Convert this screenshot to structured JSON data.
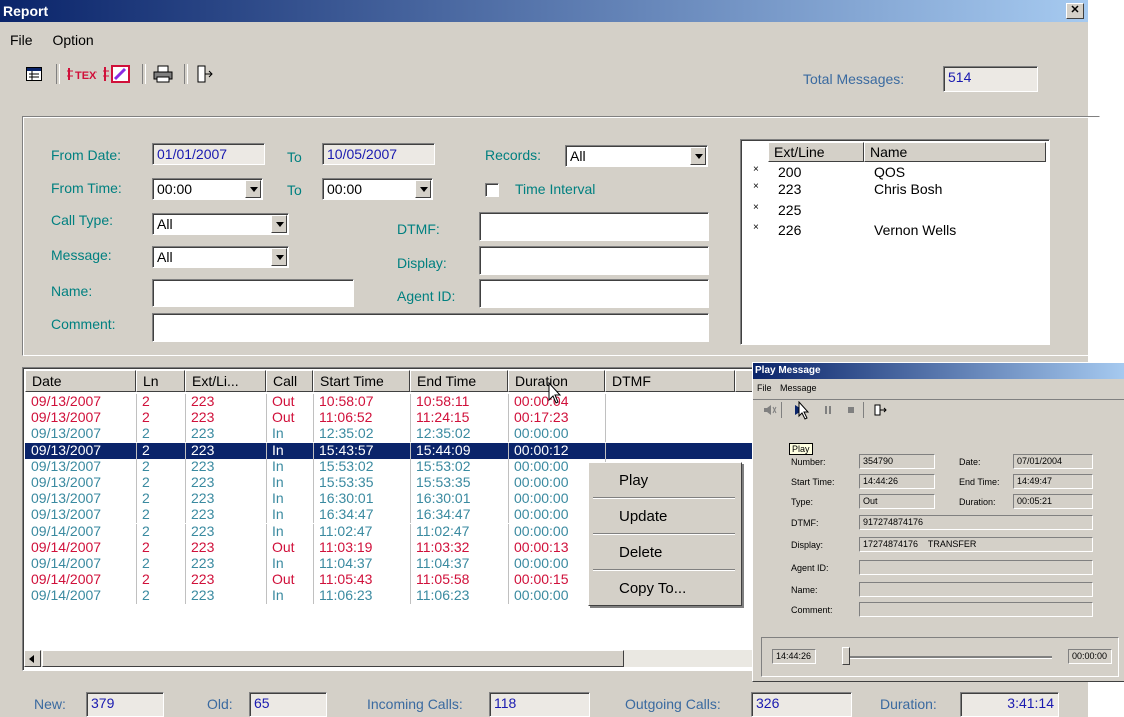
{
  "window": {
    "title": "Report",
    "close_glyph": "✕"
  },
  "menu": [
    "File",
    "Option"
  ],
  "toolbar": {
    "icons": [
      "report-view-icon",
      "text-export-icon",
      "edit-export-icon",
      "print-icon",
      "exit-icon"
    ],
    "total_label": "Total Messages:",
    "total_value": "514"
  },
  "filters": {
    "from_date_label": "From Date:",
    "from_date": "01/01/2007",
    "to_label": "To",
    "to_date": "10/05/2007",
    "records_label": "Records:",
    "records_value": "All",
    "from_time_label": "From Time:",
    "from_time": "00:00",
    "to_time_label": "To",
    "to_time": "00:00",
    "time_interval_label": "Time Interval",
    "call_type_label": "Call Type:",
    "call_type_value": "All",
    "dtmf_label": "DTMF:",
    "dtmf_value": "",
    "message_label": "Message:",
    "message_value": "All",
    "display_label": "Display:",
    "display_value": "",
    "name_label": "Name:",
    "name_value": "",
    "agent_label": "Agent ID:",
    "agent_value": "",
    "comment_label": "Comment:",
    "comment_value": ""
  },
  "ext_list": {
    "headers": [
      "Ext/Line",
      "Name"
    ],
    "rows": [
      {
        "mark": "×",
        "ext": "200",
        "name": "QOS"
      },
      {
        "mark": "×",
        "ext": "223",
        "name": "Chris Bosh"
      },
      {
        "mark": "×",
        "ext": "225",
        "name": ""
      },
      {
        "mark": "×",
        "ext": "226",
        "name": "Vernon Wells"
      }
    ]
  },
  "grid": {
    "headers": [
      "Date",
      "Ln",
      "Ext/Li...",
      "Call",
      "Start Time",
      "End Time",
      "Duration",
      "DTMF"
    ],
    "rows": [
      {
        "date": "09/13/2007",
        "ln": "2",
        "ext": "223",
        "call": "Out",
        "start": "10:58:07",
        "end": "10:58:11",
        "dur": "00:00:04",
        "type": "out"
      },
      {
        "date": "09/13/2007",
        "ln": "2",
        "ext": "223",
        "call": "Out",
        "start": "11:06:52",
        "end": "11:24:15",
        "dur": "00:17:23",
        "type": "out"
      },
      {
        "date": "09/13/2007",
        "ln": "2",
        "ext": "223",
        "call": "In",
        "start": "12:35:02",
        "end": "12:35:02",
        "dur": "00:00:00",
        "type": "in"
      },
      {
        "date": "09/13/2007",
        "ln": "2",
        "ext": "223",
        "call": "In",
        "start": "15:43:57",
        "end": "15:44:09",
        "dur": "00:00:12",
        "type": "sel"
      },
      {
        "date": "09/13/2007",
        "ln": "2",
        "ext": "223",
        "call": "In",
        "start": "15:53:02",
        "end": "15:53:02",
        "dur": "00:00:00",
        "type": "in"
      },
      {
        "date": "09/13/2007",
        "ln": "2",
        "ext": "223",
        "call": "In",
        "start": "15:53:35",
        "end": "15:53:35",
        "dur": "00:00:00",
        "type": "in"
      },
      {
        "date": "09/13/2007",
        "ln": "2",
        "ext": "223",
        "call": "In",
        "start": "16:30:01",
        "end": "16:30:01",
        "dur": "00:00:00",
        "type": "in"
      },
      {
        "date": "09/13/2007",
        "ln": "2",
        "ext": "223",
        "call": "In",
        "start": "16:34:47",
        "end": "16:34:47",
        "dur": "00:00:00",
        "type": "in"
      },
      {
        "date": "09/14/2007",
        "ln": "2",
        "ext": "223",
        "call": "In",
        "start": "11:02:47",
        "end": "11:02:47",
        "dur": "00:00:00",
        "type": "in"
      },
      {
        "date": "09/14/2007",
        "ln": "2",
        "ext": "223",
        "call": "Out",
        "start": "11:03:19",
        "end": "11:03:32",
        "dur": "00:00:13",
        "type": "out"
      },
      {
        "date": "09/14/2007",
        "ln": "2",
        "ext": "223",
        "call": "In",
        "start": "11:04:37",
        "end": "11:04:37",
        "dur": "00:00:00",
        "type": "in"
      },
      {
        "date": "09/14/2007",
        "ln": "2",
        "ext": "223",
        "call": "Out",
        "start": "11:05:43",
        "end": "11:05:58",
        "dur": "00:00:15",
        "type": "out"
      },
      {
        "date": "09/14/2007",
        "ln": "2",
        "ext": "223",
        "call": "In",
        "start": "11:06:23",
        "end": "11:06:23",
        "dur": "00:00:00",
        "type": "in"
      }
    ]
  },
  "context_menu": [
    "Play",
    "Update",
    "Delete",
    "Copy To..."
  ],
  "status": {
    "new_label": "New:",
    "new_value": "379",
    "old_label": "Old:",
    "old_value": "65",
    "incoming_label": "Incoming Calls:",
    "incoming_value": "118",
    "outgoing_label": "Outgoing Calls:",
    "outgoing_value": "326",
    "duration_label": "Duration:",
    "duration_value": "3:41:14"
  },
  "play_message": {
    "title": "Play Message",
    "menu": [
      "File",
      "Message"
    ],
    "tooltip": "Play",
    "number_label": "Number:",
    "number_value": "354790",
    "date_label": "Date:",
    "date_value": "07/01/2004",
    "start_label": "Start Time:",
    "start_value": "14:44:26",
    "end_label": "End Time:",
    "end_value": "14:49:47",
    "type_label": "Type:",
    "type_value": "Out",
    "duration_label": "Duration:",
    "duration_value": "00:05:21",
    "dtmf_label": "DTMF:",
    "dtmf_value": "917274874176",
    "display_label": "Display:",
    "display_value": "17274874176    TRANSFER",
    "agent_label": "Agent ID:",
    "agent_value": "",
    "name_label": "Name:",
    "name_value": "",
    "comment_label": "Comment:",
    "comment_value": "",
    "slider_start": "14:44:26",
    "slider_end": "00:00:00",
    "playback_position": 0.0
  },
  "colors": {
    "out": "#d0103a",
    "in": "#3a8aa0",
    "selected": "#0a246a",
    "label": "#008080"
  }
}
